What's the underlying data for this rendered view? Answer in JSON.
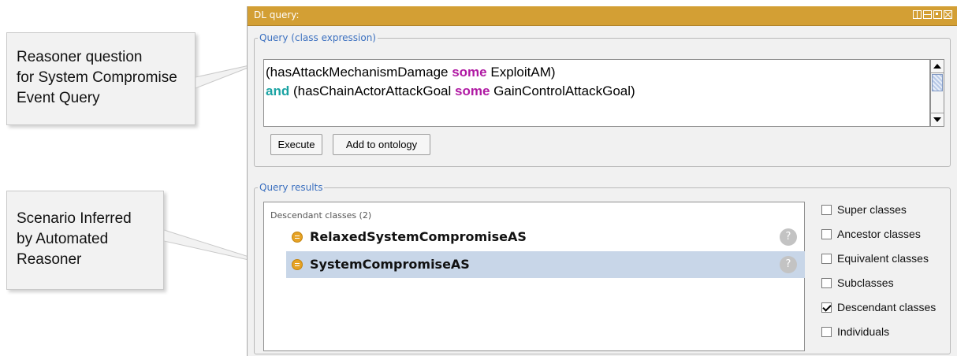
{
  "callouts": [
    {
      "lines": [
        "Reasoner question",
        "for System Compromise",
        "Event Query"
      ]
    },
    {
      "lines": [
        "Scenario Inferred",
        "by Automated",
        "Reasoner"
      ]
    }
  ],
  "window": {
    "title": "DL query:"
  },
  "query_group": {
    "legend": "Query (class expression)",
    "lines": [
      [
        {
          "text": "(hasAttackMechanismDamage ",
          "kind": "plain"
        },
        {
          "text": "some",
          "kind": "some"
        },
        {
          "text": " ExploitAM)",
          "kind": "plain"
        }
      ],
      [
        {
          "text": "and",
          "kind": "and"
        },
        {
          "text": " (hasChainActorAttackGoal ",
          "kind": "plain"
        },
        {
          "text": "some",
          "kind": "some"
        },
        {
          "text": " GainControlAttackGoal)",
          "kind": "plain"
        }
      ]
    ],
    "execute_label": "Execute",
    "add_label": "Add to ontology"
  },
  "results_group": {
    "legend": "Query results",
    "header": "Descendant classes (2)",
    "items": [
      {
        "label": "RelaxedSystemCompromiseAS",
        "selected": false,
        "help": "?"
      },
      {
        "label": "SystemCompromiseAS",
        "selected": true,
        "help": "?"
      }
    ],
    "options": [
      {
        "label": "Super classes",
        "checked": false
      },
      {
        "label": "Ancestor classes",
        "checked": false
      },
      {
        "label": "Equivalent classes",
        "checked": false
      },
      {
        "label": "Subclasses",
        "checked": false
      },
      {
        "label": "Descendant classes",
        "checked": true
      },
      {
        "label": "Individuals",
        "checked": false
      }
    ]
  },
  "colors": {
    "titlebar": "#d39f34",
    "legend": "#3a6fbf",
    "keyword_some": "#b01aa3",
    "keyword_and": "#1ba3a3",
    "selection": "#c8d6e8",
    "class_icon": "#e6a224"
  },
  "icons": {
    "window_controls": [
      "float-icon",
      "minimize-icon",
      "maximize-icon",
      "close-icon"
    ],
    "class": "class-icon",
    "help": "help-icon",
    "scroll_up": "arrow-up-icon",
    "scroll_down": "arrow-down-icon"
  }
}
